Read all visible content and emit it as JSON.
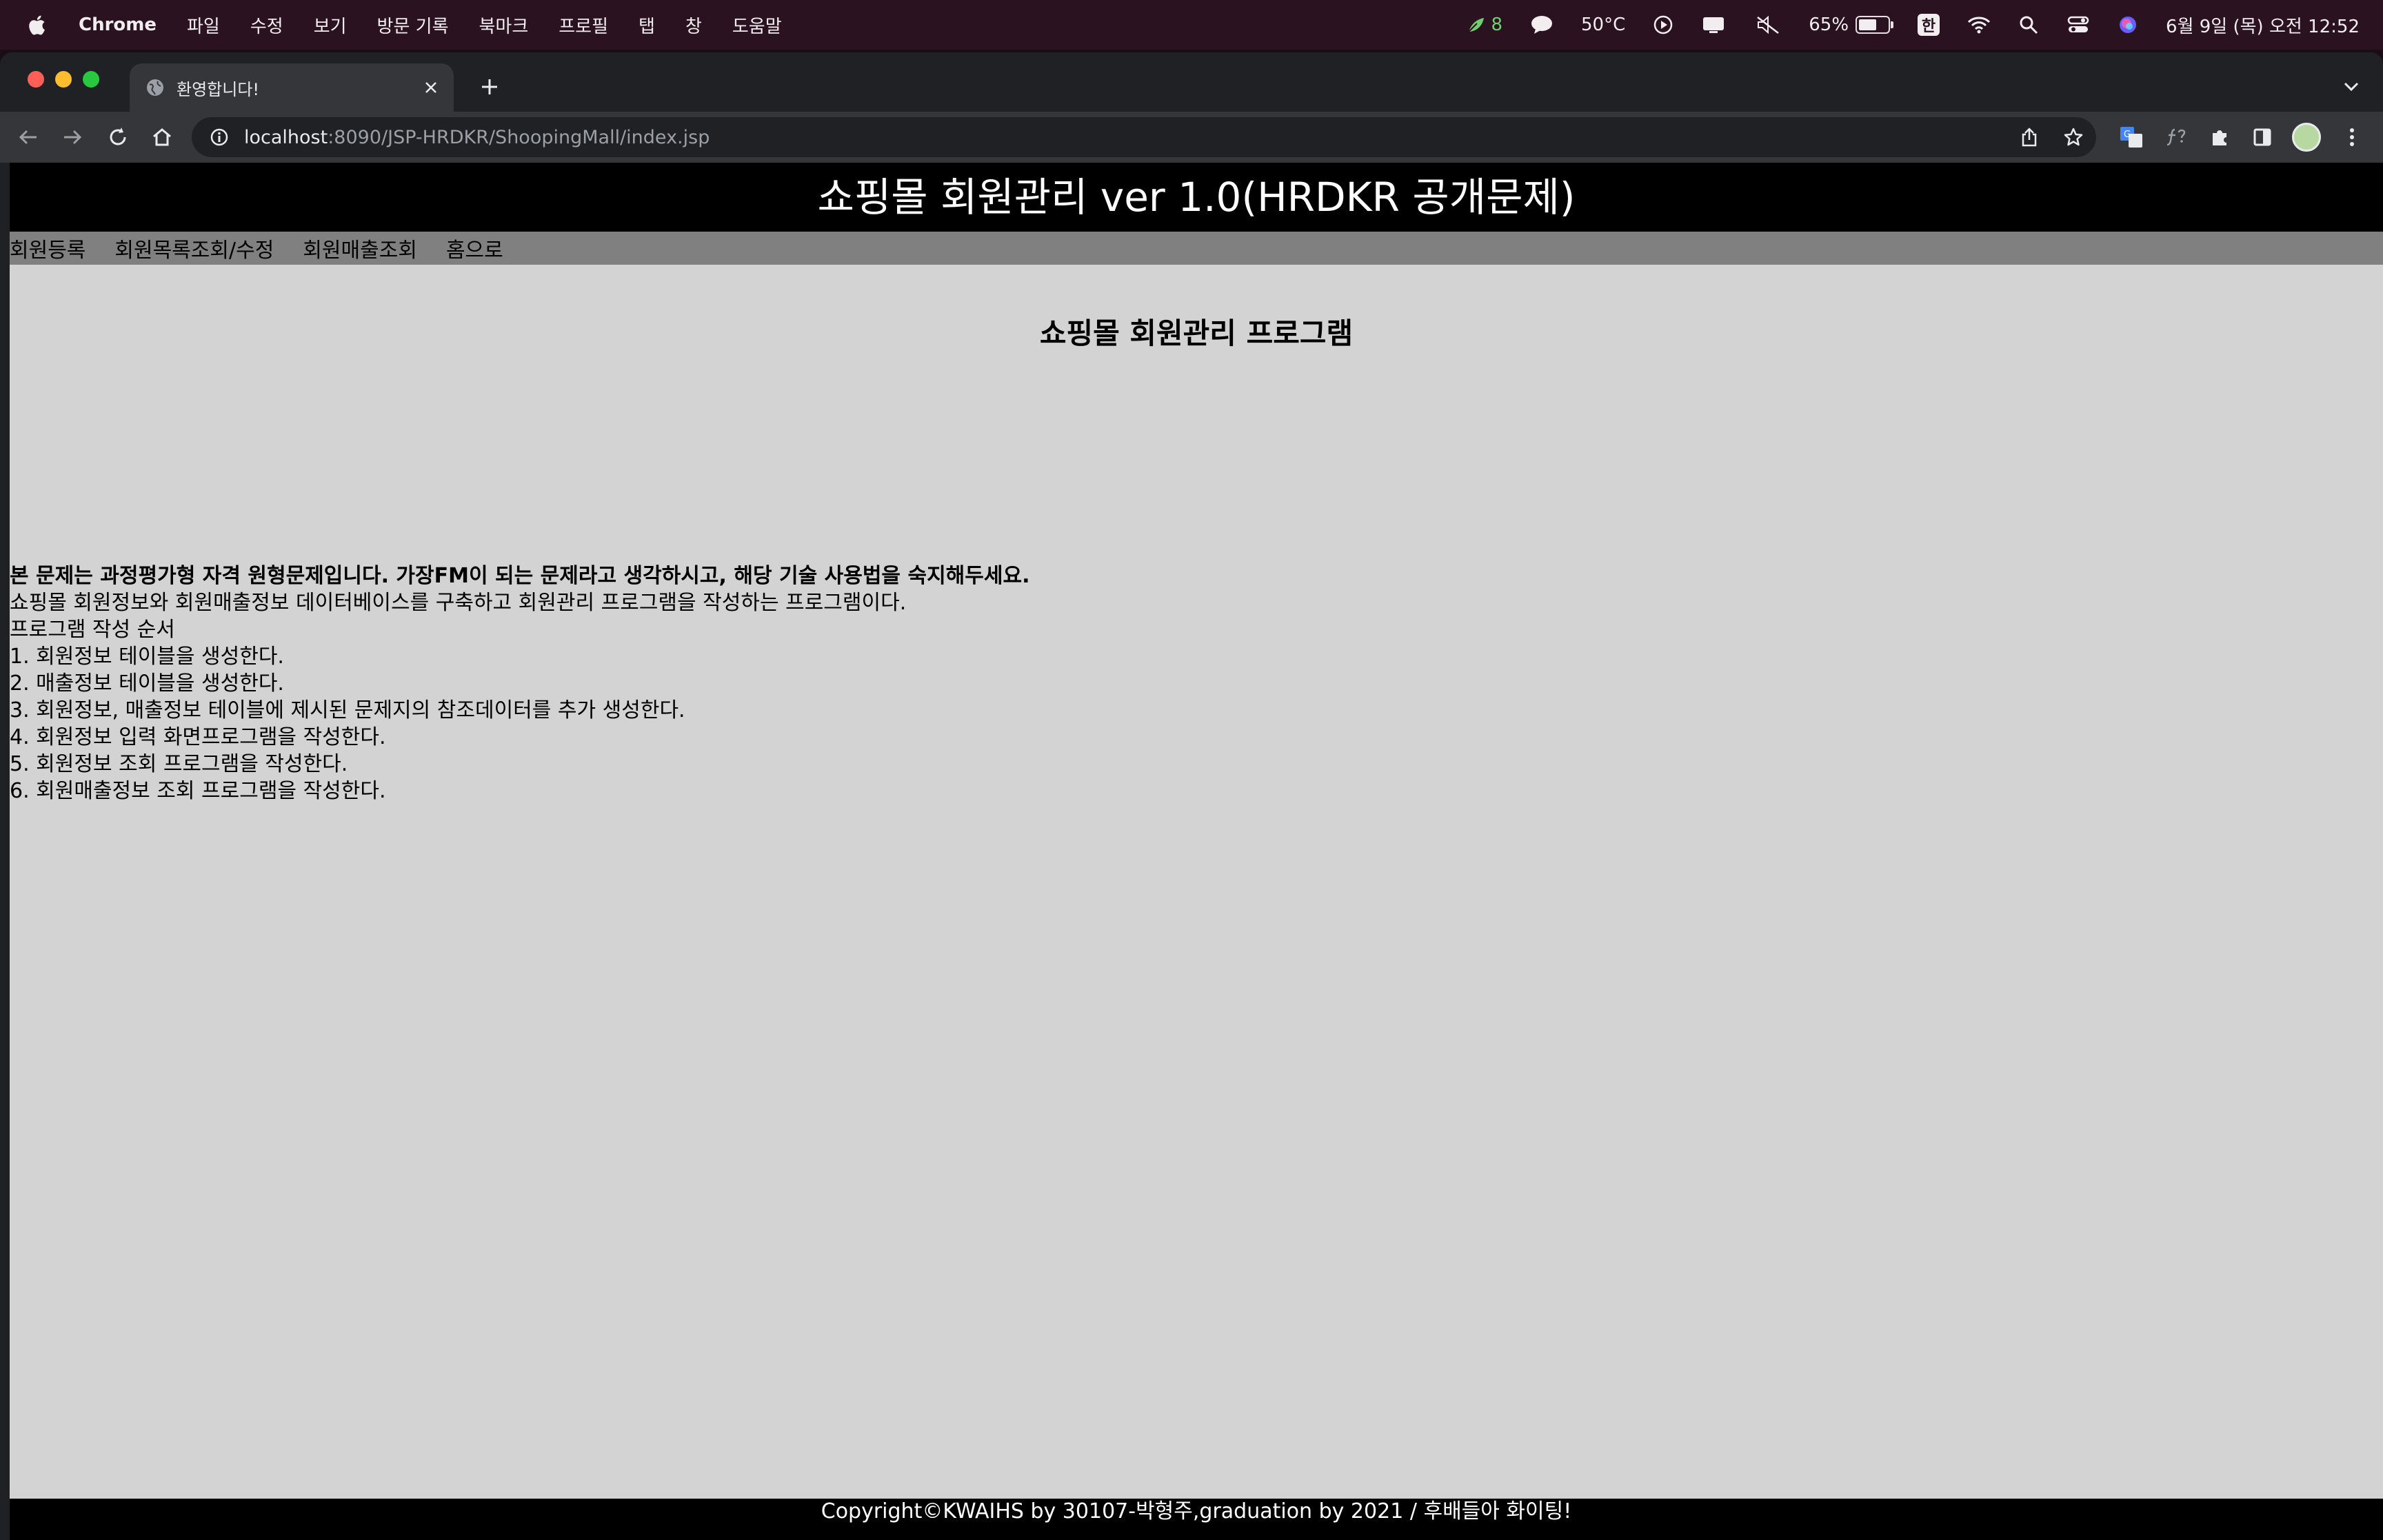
{
  "menubar": {
    "app_name": "Chrome",
    "menus": [
      "파일",
      "수정",
      "보기",
      "방문 기록",
      "북마크",
      "프로필",
      "탭",
      "창",
      "도움말"
    ],
    "status": {
      "leaf_count": "8",
      "temperature": "50°C",
      "battery": "65%",
      "battery_level": 0.65,
      "ime": "한",
      "datetime": "6월 9일 (목) 오전 12:52"
    }
  },
  "browser": {
    "tab_title": "환영합니다!",
    "url_host": "localhost",
    "url_rest": ":8090/JSP-HRDKR/ShoopingMall/index.jsp"
  },
  "page": {
    "header": "쇼핑몰 회원관리 ver 1.0(HRDKR 공개문제)",
    "nav": [
      "회원등록",
      "회원목록조회/수정",
      "회원매출조회",
      "홈으로"
    ],
    "title": "쇼핑몰 회원관리 프로그램",
    "intro_bold": "본 문제는 과정평가형 자격 원형문제입니다. 가장FM이 되는 문제라고 생각하시고, 해당 기술 사용법을 숙지해두세요.",
    "intro_lines": [
      "쇼핑몰 회원정보와 회원매출정보 데이터베이스를 구축하고 회원관리 프로그램을 작성하는 프로그램이다.",
      "프로그램 작성 순서",
      "1. 회원정보 테이블을 생성한다.",
      "2. 매출정보 테이블을 생성한다.",
      "3. 회원정보, 매출정보 테이블에 제시된 문제지의 참조데이터를 추가 생성한다.",
      "4. 회원정보 입력 화면프로그램을 작성한다.",
      "5. 회원정보 조회 프로그램을 작성한다.",
      "6. 회원매출정보 조회 프로그램을 작성한다."
    ],
    "footer": "Copyright©KWAIHS by 30107-박형주,graduation by 2021 / 후배들아 화이팅!"
  }
}
